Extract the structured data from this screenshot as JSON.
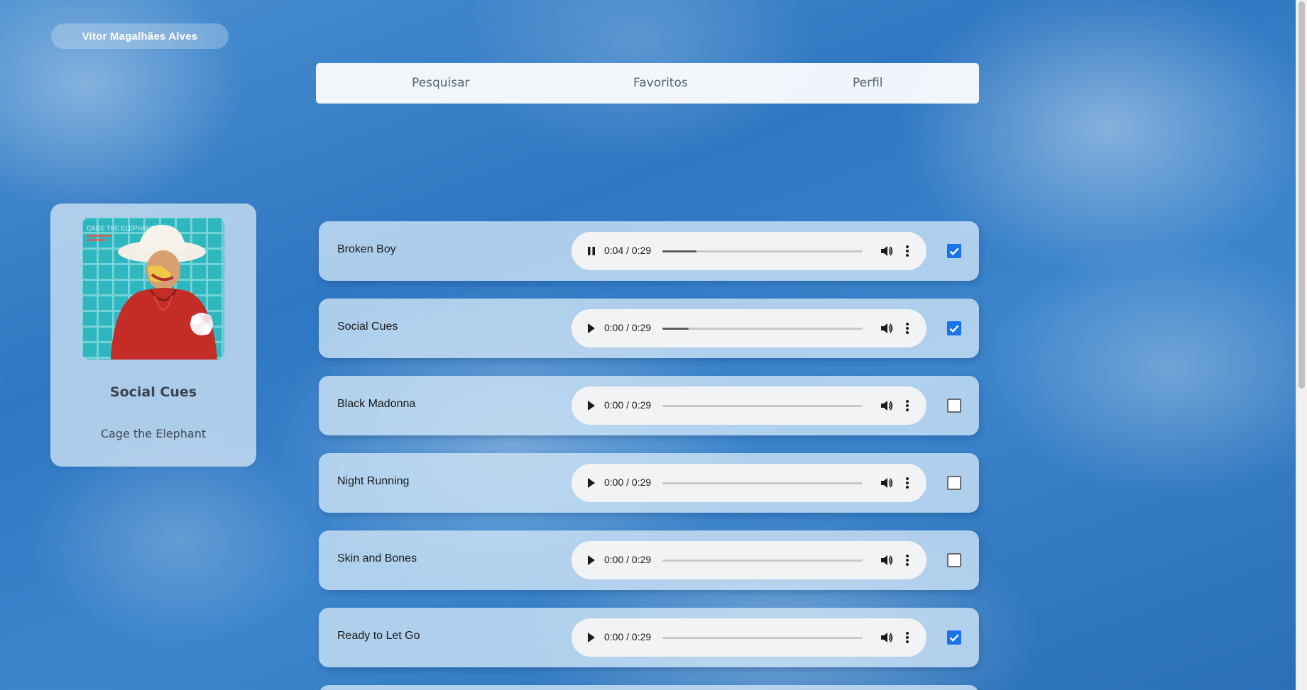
{
  "user": {
    "name": "Vitor Magalhães Alves"
  },
  "nav": {
    "items": [
      "Pesquisar",
      "Favoritos",
      "Perfil"
    ]
  },
  "album": {
    "title": "Social Cues",
    "artist": "Cage the Elephant",
    "cover_text": "CAGE THE ELEPHANT"
  },
  "tracks": [
    {
      "name": "Broken Boy",
      "time": "0:04 / 0:29",
      "playing": true,
      "progress": 0.17,
      "favorite": true
    },
    {
      "name": "Social Cues",
      "time": "0:00 / 0:29",
      "playing": false,
      "progress": 0.13,
      "favorite": true
    },
    {
      "name": "Black Madonna",
      "time": "0:00 / 0:29",
      "playing": false,
      "progress": 0,
      "favorite": false
    },
    {
      "name": "Night Running",
      "time": "0:00 / 0:29",
      "playing": false,
      "progress": 0,
      "favorite": false
    },
    {
      "name": "Skin and Bones",
      "time": "0:00 / 0:29",
      "playing": false,
      "progress": 0,
      "favorite": false
    },
    {
      "name": "Ready to Let Go",
      "time": "0:00 / 0:29",
      "playing": false,
      "progress": 0,
      "favorite": true
    }
  ],
  "colors": {
    "checkbox_accent": "#1a73e8",
    "player_bg": "#f1f3f4"
  }
}
